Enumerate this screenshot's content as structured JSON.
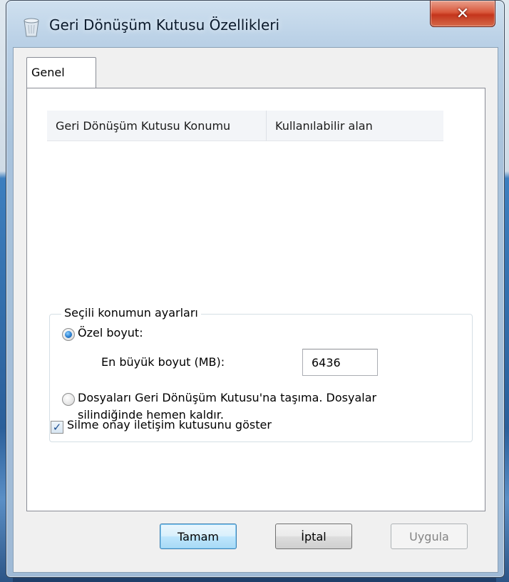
{
  "window": {
    "title": "Geri Dönüşüm Kutusu Özellikleri",
    "close_label": "✕",
    "icon": "recycle-bin-icon"
  },
  "tabs": [
    {
      "label": "Genel",
      "selected": true
    }
  ],
  "listview": {
    "columns": [
      "Geri Dönüşüm Kutusu Konumu",
      "Kullanılabilir alan"
    ],
    "rows": []
  },
  "location_settings": {
    "group_title": "Seçili konumun ayarları",
    "custom_size_label": "Özel boyut:",
    "custom_size_selected": true,
    "max_size_label": "En büyük boyut (MB):",
    "max_size_value": "6436",
    "no_recycle_line1": "Dosyaları Geri Dönüşüm Kutusu'na taşıma. Dosyalar",
    "no_recycle_line2": "silindiğinde hemen kaldır.",
    "no_recycle_selected": false
  },
  "confirm_delete": {
    "label": "Silme onay iletişim kutusunu göster",
    "checked": true
  },
  "buttons": {
    "ok": "Tamam",
    "cancel": "İptal",
    "apply": "Uygula"
  },
  "colors": {
    "close_button": "#c4351c",
    "default_button_border": "#3c7fb1",
    "radio_checked": "#2b7fd0"
  }
}
